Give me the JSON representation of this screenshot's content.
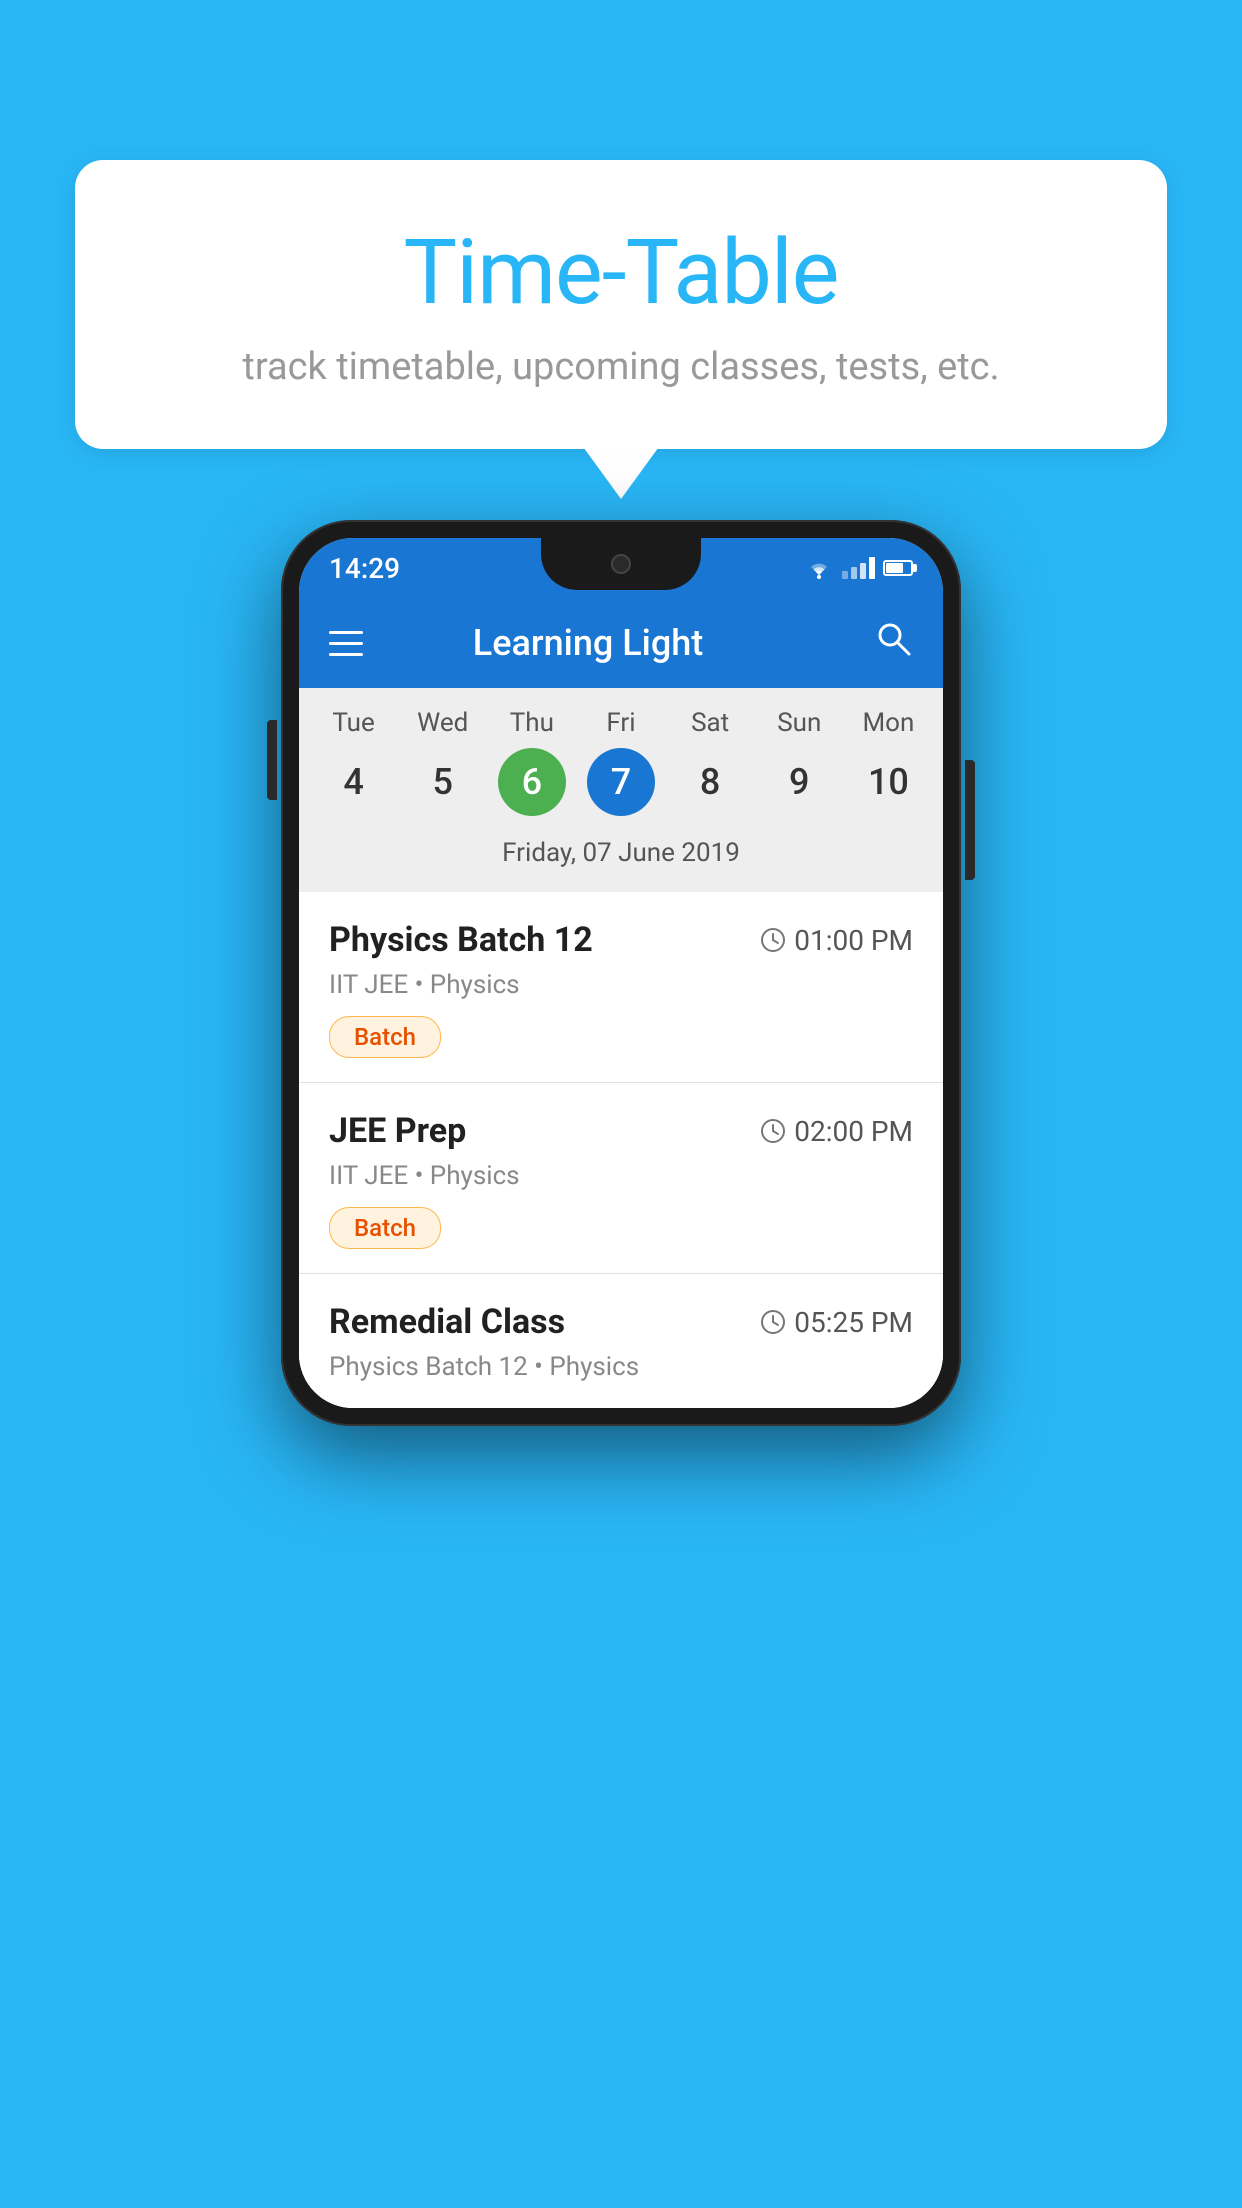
{
  "background_color": "#29B6F6",
  "speech_bubble": {
    "title": "Time-Table",
    "subtitle": "track timetable, upcoming classes, tests, etc."
  },
  "phone": {
    "status_bar": {
      "time": "14:29"
    },
    "app_bar": {
      "title": "Learning Light"
    },
    "calendar": {
      "days": [
        {
          "name": "Tue",
          "num": "4",
          "state": "normal"
        },
        {
          "name": "Wed",
          "num": "5",
          "state": "normal"
        },
        {
          "name": "Thu",
          "num": "6",
          "state": "today"
        },
        {
          "name": "Fri",
          "num": "7",
          "state": "selected"
        },
        {
          "name": "Sat",
          "num": "8",
          "state": "normal"
        },
        {
          "name": "Sun",
          "num": "9",
          "state": "normal"
        },
        {
          "name": "Mon",
          "num": "10",
          "state": "normal"
        }
      ],
      "selected_date_label": "Friday, 07 June 2019"
    },
    "schedule_items": [
      {
        "title": "Physics Batch 12",
        "time": "01:00 PM",
        "subtitle": "IIT JEE • Physics",
        "badge": "Batch"
      },
      {
        "title": "JEE Prep",
        "time": "02:00 PM",
        "subtitle": "IIT JEE • Physics",
        "badge": "Batch"
      },
      {
        "title": "Remedial Class",
        "time": "05:25 PM",
        "subtitle": "Physics Batch 12 • Physics",
        "badge": null
      }
    ]
  }
}
